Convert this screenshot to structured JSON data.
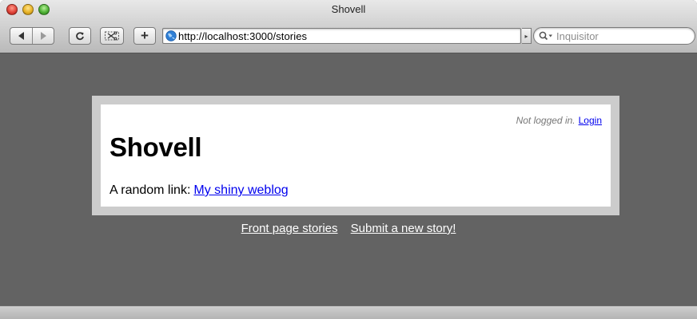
{
  "window": {
    "title": "Shovell"
  },
  "toolbar": {
    "url": "http://localhost:3000/stories",
    "search_placeholder": "Inquisitor",
    "plus_label": "+",
    "reload_label": "c"
  },
  "page": {
    "login_status": "Not logged in.",
    "login_link": "Login",
    "site_title": "Shovell",
    "random_link_prefix": "A random link:",
    "random_link_text": "My shiny weblog",
    "nav": [
      {
        "label": "Front page stories"
      },
      {
        "label": "Submit a new story!"
      }
    ]
  },
  "colors": {
    "page_background": "#636363",
    "frame": "#cccccc",
    "link": "#0000ee"
  }
}
